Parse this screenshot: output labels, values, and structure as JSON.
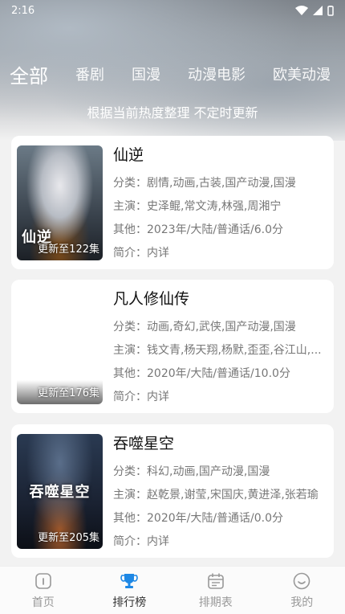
{
  "status_bar": {
    "time": "2:16"
  },
  "tabs": [
    {
      "label": "全部",
      "active": true
    },
    {
      "label": "番剧",
      "active": false
    },
    {
      "label": "国漫",
      "active": false
    },
    {
      "label": "动漫电影",
      "active": false
    },
    {
      "label": "欧美动漫",
      "active": false
    }
  ],
  "subtitle": "根据当前热度整理 不定时更新",
  "cards": [
    {
      "title": "仙逆",
      "poster_logo": "仙逆",
      "episode_badge": "更新至122集",
      "genre": "分类：剧情,动画,古装,国产动漫,国漫",
      "cast": "主演：史泽鲲,常文涛,林强,周湘宁",
      "other": "其他：2023年/大陆/普通话/6.0分",
      "intro": "简介：内详"
    },
    {
      "title": "凡人修仙传",
      "poster_logo": "",
      "episode_badge": "更新至176集",
      "genre": "分类：动画,奇幻,武侠,国产动漫,国漫",
      "cast": "主演：钱文青,杨天翔,杨默,歪歪,谷江山,...",
      "other": "其他：2020年/大陆/普通话/10.0分",
      "intro": "简介：内详"
    },
    {
      "title": "吞噬星空",
      "poster_logo": "吞噬星空",
      "episode_badge": "更新至205集",
      "genre": "分类：科幻,动画,国产动漫,国漫",
      "cast": "主演：赵乾景,谢莹,宋国庆,黄进泽,张若瑜",
      "other": "其他：2020年/大陆/普通话/0.0分",
      "intro": "简介：内详"
    }
  ],
  "bottom_nav": [
    {
      "label": "首页",
      "icon": "home-icon",
      "active": false
    },
    {
      "label": "排行榜",
      "icon": "trophy-icon",
      "active": true
    },
    {
      "label": "排期表",
      "icon": "calendar-icon",
      "active": false
    },
    {
      "label": "我的",
      "icon": "smile-icon",
      "active": false
    }
  ],
  "colors": {
    "accent": "#1e88e5",
    "inactive": "#999999",
    "card_bg": "#ffffff"
  }
}
